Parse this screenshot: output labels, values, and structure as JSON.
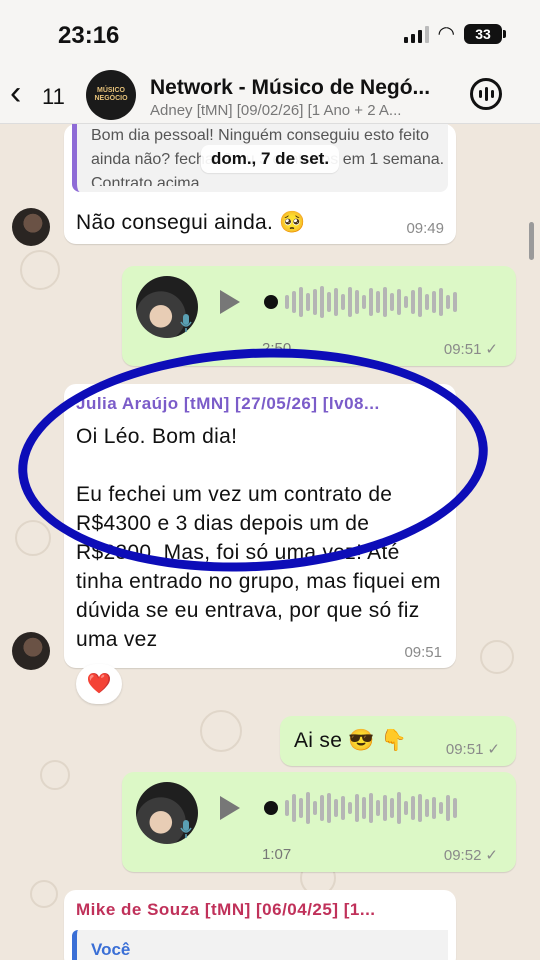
{
  "status_bar": {
    "time": "23:16",
    "battery": "33"
  },
  "header": {
    "back_count": "11",
    "avatar_text": "MÚSICO NEGÓCIO",
    "title": "Network - Músico de Negó...",
    "subtitle": "Adney [tMN] [09/02/26] [1 Ano + 2 A..."
  },
  "date_pill": "dom., 7 de set.",
  "messages": {
    "m1": {
      "quote": "Bom dia pessoal! Ninguém conseguiu esto feito ainda não?  fechar 2 ou 3 contratos em 1 semana. Contrato acima...",
      "text": "Não consegui ainda. 🥺",
      "time": "09:49"
    },
    "voice1": {
      "duration": "2:50",
      "time": "09:51",
      "status": "read"
    },
    "m2": {
      "sender": "Julia Araújo [tMN] [27/05/26] [lv08...",
      "sender_color": "#7b5cc9",
      "text": "Oi Léo. Bom dia!\n\nEu fechei um vez um contrato de R$4300 e 3 dias depois um de R$2300. Mas, foi só uma vez! Até tinha entrado no grupo, mas fiquei em dúvida se eu entrava, por que só fiz uma vez",
      "time": "09:51",
      "reaction": "❤️"
    },
    "m3": {
      "text": "Ai se 😎 👇",
      "time": "09:51",
      "status": "read"
    },
    "voice2": {
      "duration": "1:07",
      "time": "09:52",
      "status": "read"
    },
    "m4": {
      "sender": "Mike de Souza [tMN] [06/04/25] [1...",
      "sender_color": "#c0315a",
      "quote_author": "Você"
    }
  },
  "colors": {
    "highlight": "#0d0db8",
    "outgoing": "#dcf8c6",
    "incoming": "#ffffff"
  }
}
